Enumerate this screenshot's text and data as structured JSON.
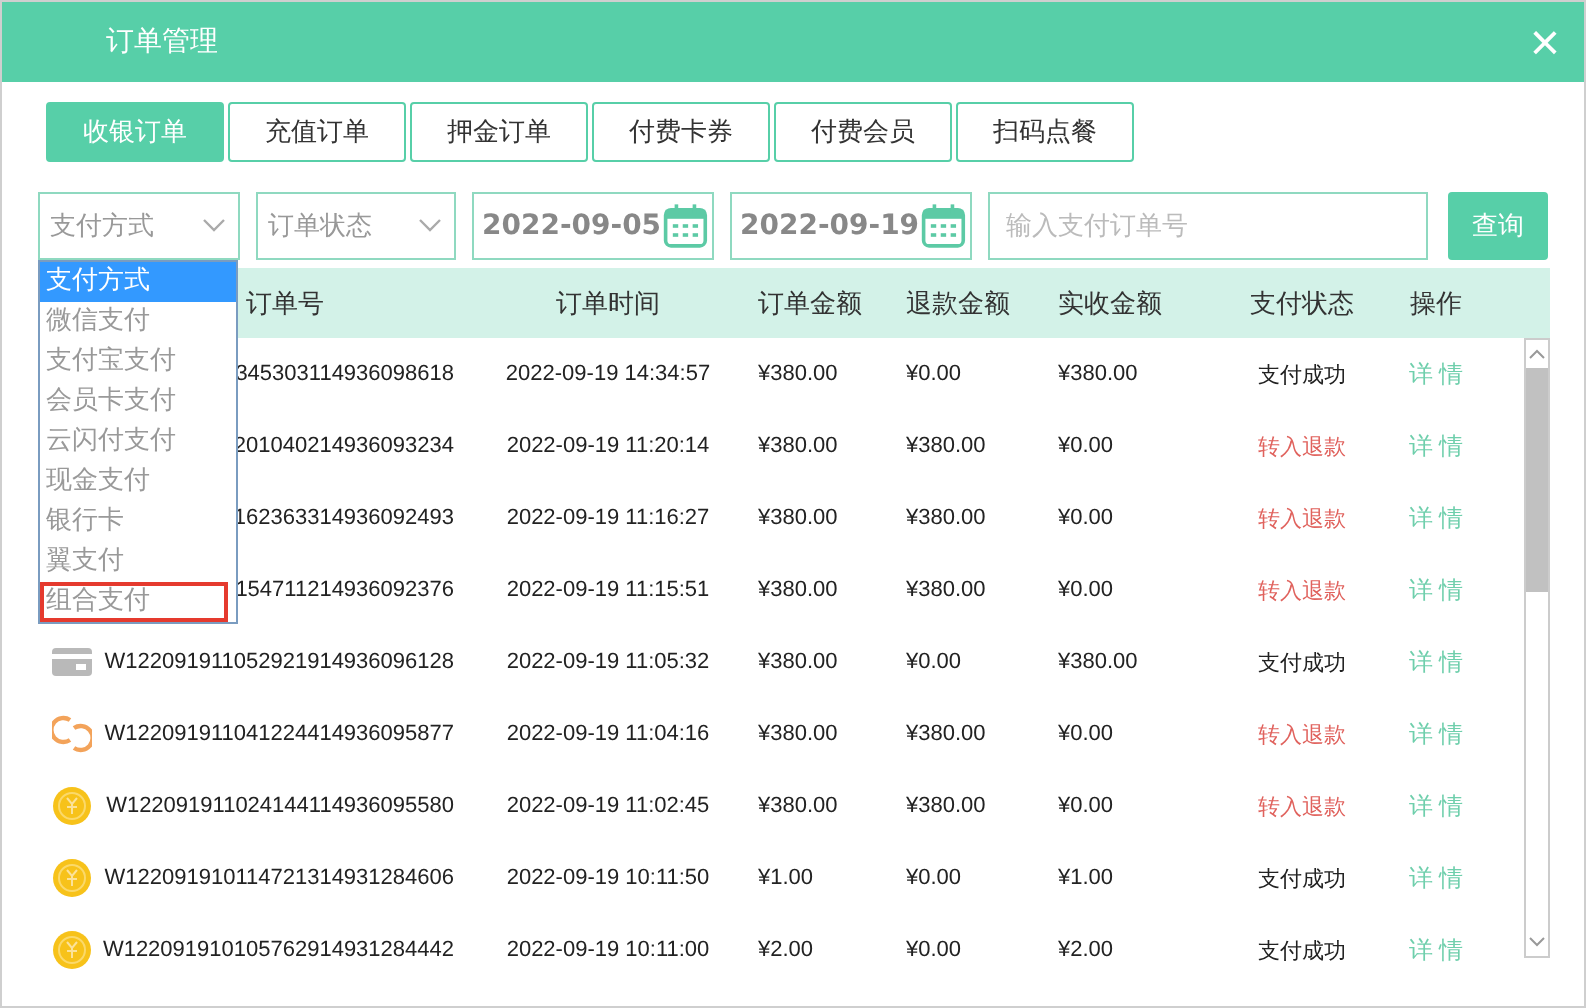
{
  "window": {
    "title": "订单管理",
    "close": "×"
  },
  "tabs": [
    {
      "label": "收银订单",
      "selected": true
    },
    {
      "label": "充值订单",
      "selected": false
    },
    {
      "label": "押金订单",
      "selected": false
    },
    {
      "label": "付费卡券",
      "selected": false
    },
    {
      "label": "付费会员",
      "selected": false
    },
    {
      "label": "扫码点餐",
      "selected": false
    }
  ],
  "filters": {
    "payment_method": {
      "value": "支付方式",
      "expanded": true,
      "options": [
        {
          "label": "支付方式",
          "selected": true,
          "highlighted": false
        },
        {
          "label": "微信支付",
          "selected": false,
          "highlighted": false
        },
        {
          "label": "支付宝支付",
          "selected": false,
          "highlighted": false
        },
        {
          "label": "会员卡支付",
          "selected": false,
          "highlighted": false
        },
        {
          "label": "云闪付支付",
          "selected": false,
          "highlighted": false
        },
        {
          "label": "现金支付",
          "selected": false,
          "highlighted": false
        },
        {
          "label": "银行卡",
          "selected": false,
          "highlighted": false
        },
        {
          "label": "翼支付",
          "selected": false,
          "highlighted": false
        },
        {
          "label": "组合支付",
          "selected": false,
          "highlighted": true
        }
      ]
    },
    "order_status": {
      "value": "订单状态"
    },
    "start_date": "2022-09-05",
    "end_date": "2022-09-19",
    "search": {
      "placeholder": "输入支付订单号"
    },
    "query_button": "查询"
  },
  "table": {
    "columns": [
      "订单号",
      "订单时间",
      "订单金额",
      "退款金额",
      "实收金额",
      "支付状态",
      "操作"
    ],
    "rows": [
      {
        "order_no": "345303114936098618",
        "time": "2022-09-19 14:34:57",
        "amount": "¥380.00",
        "refund": "¥0.00",
        "received": "¥380.00",
        "status": {
          "text": "支付成功",
          "kind": "success"
        },
        "action": "详 情"
      },
      {
        "order_no": "201040214936093234",
        "time": "2022-09-19 11:20:14",
        "amount": "¥380.00",
        "refund": "¥380.00",
        "received": "¥0.00",
        "status": {
          "text": "转入退款",
          "kind": "refund"
        },
        "action": "详 情"
      },
      {
        "order_no": "162363314936092493",
        "time": "2022-09-19 11:16:27",
        "amount": "¥380.00",
        "refund": "¥380.00",
        "received": "¥0.00",
        "status": {
          "text": "转入退款",
          "kind": "refund"
        },
        "action": "详 情"
      },
      {
        "order_no": "154711214936092376",
        "time": "2022-09-19 11:15:51",
        "amount": "¥380.00",
        "refund": "¥380.00",
        "received": "¥0.00",
        "status": {
          "text": "转入退款",
          "kind": "refund"
        },
        "action": "详 情"
      },
      {
        "kind": "card",
        "order_no": "W122091911052921914936096128",
        "time": "2022-09-19 11:05:32",
        "amount": "¥380.00",
        "refund": "¥0.00",
        "received": "¥380.00",
        "status": {
          "text": "支付成功",
          "kind": "success"
        },
        "action": "详 情"
      },
      {
        "kind": "swirl",
        "order_no": "W122091911041224414936095877",
        "time": "2022-09-19 11:04:16",
        "amount": "¥380.00",
        "refund": "¥380.00",
        "received": "¥0.00",
        "status": {
          "text": "转入退款",
          "kind": "refund"
        },
        "action": "详 情"
      },
      {
        "kind": "coin",
        "order_no": "W122091911024144114936095580",
        "time": "2022-09-19 11:02:45",
        "amount": "¥380.00",
        "refund": "¥380.00",
        "received": "¥0.00",
        "status": {
          "text": "转入退款",
          "kind": "refund"
        },
        "action": "详 情"
      },
      {
        "kind": "coin",
        "order_no": "W122091910114721314931284606",
        "time": "2022-09-19 10:11:50",
        "amount": "¥1.00",
        "refund": "¥0.00",
        "received": "¥1.00",
        "status": {
          "text": "支付成功",
          "kind": "success"
        },
        "action": "详 情"
      },
      {
        "kind": "coin",
        "order_no": "W122091910105762914931284442",
        "time": "2022-09-19 10:11:00",
        "amount": "¥2.00",
        "refund": "¥0.00",
        "received": "¥2.00",
        "status": {
          "text": "支付成功",
          "kind": "success"
        },
        "action": "详 情"
      }
    ]
  }
}
